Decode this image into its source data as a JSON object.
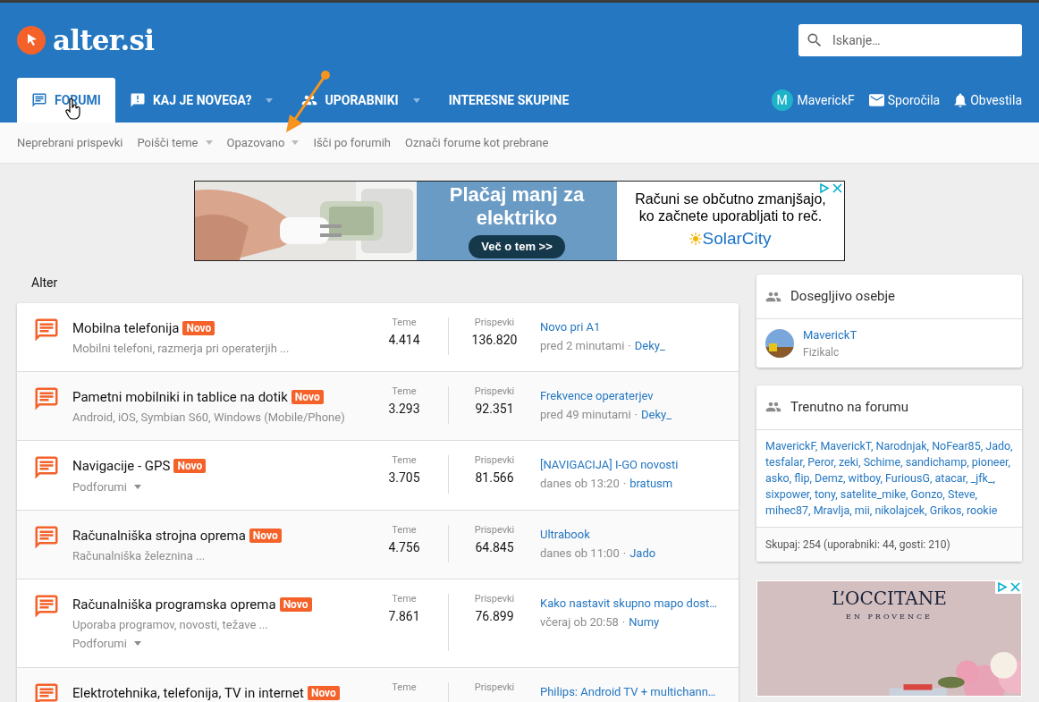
{
  "logo": {
    "text": "alter.si"
  },
  "search": {
    "placeholder": "Iskanje…"
  },
  "tabs": [
    {
      "label": "FORUMI",
      "kind": "chat",
      "caret": false,
      "selected": true
    },
    {
      "label": "KAJ JE NOVEGA?",
      "kind": "alert",
      "caret": true,
      "selected": false
    },
    {
      "label": "UPORABNIKI",
      "kind": "people",
      "caret": true,
      "selected": false
    },
    {
      "label": "INTERESNE SKUPINE",
      "kind": "plain",
      "caret": false,
      "selected": false
    }
  ],
  "user_nav": {
    "avatar_letter": "M",
    "username": "MaverickF",
    "messages": "Sporočila",
    "alerts": "Obvestila"
  },
  "subnav": [
    {
      "label": "Neprebrani prispevki",
      "caret": false
    },
    {
      "label": "Poišči teme",
      "caret": true
    },
    {
      "label": "Opazovano",
      "caret": true
    },
    {
      "label": "Išči po forumih",
      "caret": false
    },
    {
      "label": "Označi forume kot prebrane",
      "caret": false
    }
  ],
  "top_ad": {
    "headline": "Plačaj manj za elektriko",
    "button": "Več o tem >>",
    "text": "Računi se občutno zmanjšajo, ko začnete uporabljati to reč.",
    "brand": "SolarCity"
  },
  "section_title": "Alter",
  "forums": [
    {
      "title": "Mobilna telefonija",
      "badge": "Novo",
      "description": "Mobilni telefoni, razmerja pri operaterjih ...",
      "threads_label": "Teme",
      "threads": "4.414",
      "posts_label": "Prispevki",
      "posts": "136.820",
      "last_title": "Novo pri A1",
      "last_time": "pred 2 minutami",
      "separator": "·",
      "last_user": "Deky_"
    },
    {
      "title": "Pametni mobilniki in tablice na dotik",
      "badge": "Novo",
      "description": "Android, iOS, Symbian S60, Windows (Mobile/Phone)",
      "threads_label": "Teme",
      "threads": "3.293",
      "posts_label": "Prispevki",
      "posts": "92.351",
      "last_title": "Frekvence operaterjev",
      "last_time": "pred 49 minutami",
      "separator": "·",
      "last_user": "Deky_"
    },
    {
      "title": "Navigacije - GPS",
      "badge": "Novo",
      "subforums": "Podforumi",
      "threads_label": "Teme",
      "threads": "3.705",
      "posts_label": "Prispevki",
      "posts": "81.566",
      "last_title": "[NAVIGACIJA] I-GO novosti",
      "last_time": "danes ob 13:20",
      "separator": "·",
      "last_user": "bratusm"
    },
    {
      "title": "Računalniška strojna oprema",
      "badge": "Novo",
      "description": "Računalniška železnina ...",
      "threads_label": "Teme",
      "threads": "4.756",
      "posts_label": "Prispevki",
      "posts": "64.845",
      "last_title": "Ultrabook",
      "last_time": "danes ob 11:00",
      "separator": "·",
      "last_user": "Jado"
    },
    {
      "title": "Računalniška programska oprema",
      "badge": "Novo",
      "description": "Uporaba programov, novosti, težave ...",
      "subforums": "Podforumi",
      "threads_label": "Teme",
      "threads": "7.861",
      "posts_label": "Prispevki",
      "posts": "76.899",
      "last_title": "Kako nastavit skupno mapo dost…",
      "last_time": "včeraj ob 20:58",
      "separator": "·",
      "last_user": "Numy"
    },
    {
      "title": "Elektrotehnika, telefonija, TV in internet",
      "badge": "Novo",
      "threads_label": "Teme",
      "posts_label": "Prispevki",
      "last_title": "Philips: Android TV + multichann…"
    }
  ],
  "staff_widget": {
    "title": "Dosegljivo osebje",
    "member": {
      "name": "MaverickT",
      "role": "Fizikalc"
    }
  },
  "online_widget": {
    "title": "Trenutno na forumu",
    "users": [
      "MaverickF,",
      "MaverickT,",
      "Narodnjak,",
      "NoFear85,",
      "Jado,",
      "tesfalar,",
      "Peror,",
      "zeki,",
      "Schime,",
      "sandichamp,",
      "pioneer,",
      "asko,",
      "flip,",
      "Demz,",
      "witboy,",
      "FuriousG,",
      "atacar,",
      "_jfk_,",
      "sixpower,",
      "tony,",
      "satelite_mike,",
      "Gonzo,",
      "Steve,",
      "mihec87,",
      "Mravlja,",
      "mii,",
      "nikolajcek,",
      "Grikos,",
      "rookie"
    ],
    "total": "Skupaj: 254 (uporabniki: 44, gosti: 210)"
  },
  "side_ad": {
    "brand": "L’OCCITANE",
    "tagline": "EN PROVENCE"
  }
}
